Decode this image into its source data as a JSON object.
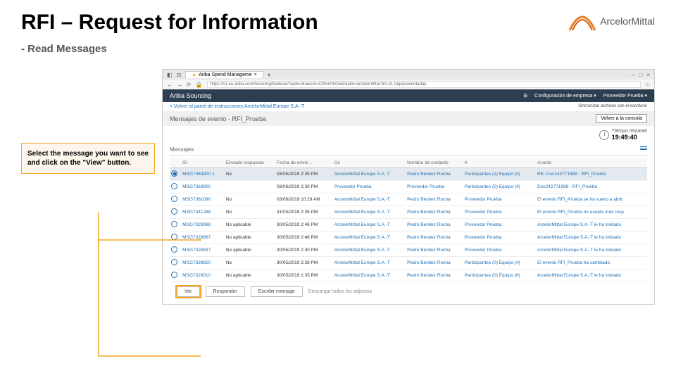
{
  "slide": {
    "title": "RFI – Request for Information",
    "subtitle": "- Read Messages",
    "brand": "ArcelorMittal",
    "callout": "Select the message you want to see and click on the \"View\" button."
  },
  "browser": {
    "tab_title": "Ariba Spend Manageme",
    "url": "https://s1.eu.ariba.com/Sourcing/Main/aw?awh=r&awssk=C0bmVhOe&realm=arcelormittal-NA-IA-1&passwordadap"
  },
  "app": {
    "product": "Ariba Sourcing",
    "config_label": "Configuración de empresa ▾",
    "user_label": "Proveedor Prueba ▾",
    "back_link": "< Volver al panel de instrucciones ArcelorMittal Europe S.A.-T",
    "sync_text": "Sincronizar archivos con el escritorio",
    "page_title": "Mensajes de evento - RFI_Prueba",
    "console_btn": "Volver a la consola",
    "time_label": "Tiempo restante",
    "time_value": "19:49:40",
    "messages_label": "Mensajes",
    "headers": {
      "id": "ID",
      "reply": "Enviado respuesta",
      "date": "Fecha de envío ↓",
      "from": "De",
      "contact": "Nombre de contacto",
      "to": "A",
      "subject": "Asunto"
    },
    "rows": [
      {
        "id": "MSG7363900.1",
        "reply": "No",
        "date": "03/06/2019 2:35 PM",
        "from": "ArcelorMittal Europe S.A.-T",
        "contact": "Pedro Benitez Rocha",
        "to": "Participantes (1) Equipo (4)",
        "subject": "RE: Doc242771989 - RFI_Prueba"
      },
      {
        "id": "MSG7363900",
        "reply": "",
        "date": "03/06/2019 2:30 PM",
        "from": "Proveedor Prueba",
        "contact": "Proveedor Prueba",
        "to": "Participantes (0) Equipo (4)",
        "subject": "Doc242771989 - RFI_Prueba"
      },
      {
        "id": "MSG7361090",
        "reply": "No",
        "date": "03/06/2019 10:28 AM",
        "from": "ArcelorMittal Europe S.A.-T",
        "contact": "Pedro Benitez Rocha",
        "to": "Proveedor Prueba",
        "subject": "El evento RFI_Prueba se ha vuelto a abrir."
      },
      {
        "id": "MSG7341288",
        "reply": "No",
        "date": "31/05/2019 2:35 PM",
        "from": "ArcelorMittal Europe S.A.-T",
        "contact": "Pedro Benitez Rocha",
        "to": "Proveedor Prueba",
        "subject": "El evento RFI_Prueba no acepta más resp"
      },
      {
        "id": "MSG7329988",
        "reply": "No aplicable",
        "date": "30/05/2019 2:46 PM",
        "from": "ArcelorMittal Europe S.A.-T",
        "contact": "Pedro Benitez Rocha",
        "to": "Proveedor Prueba",
        "subject": "ArcelorMittal Europe S.A.-T le ha invitado"
      },
      {
        "id": "MSG7329987",
        "reply": "No aplicable",
        "date": "30/05/2019 2:46 PM",
        "from": "ArcelorMittal Europe S.A.-T",
        "contact": "Pedro Benitez Rocha",
        "to": "Proveedor Prueba",
        "subject": "ArcelorMittal Europe S.A.-T le ha invitado"
      },
      {
        "id": "MSG7329837",
        "reply": "No aplicable",
        "date": "30/05/2019 2:30 PM",
        "from": "ArcelorMittal Europe S.A.-T",
        "contact": "Pedro Benitez Rocha",
        "to": "Proveedor Prueba",
        "subject": "ArcelorMittal Europe S.A.-T le ha invitado"
      },
      {
        "id": "MSG7329820",
        "reply": "No",
        "date": "30/05/2019 2:28 PM",
        "from": "ArcelorMittal Europe S.A.-T",
        "contact": "Pedro Benitez Rocha",
        "to": "Participantes (0) Equipo (4)",
        "subject": "El evento RFI_Prueba ha cambiado."
      },
      {
        "id": "MSG7329010",
        "reply": "No aplicable",
        "date": "30/05/2019 1:35 PM",
        "from": "ArcelorMittal Europe S.A.-T",
        "contact": "Pedro Benitez Rocha",
        "to": "Participantes (0) Equipo (0)",
        "subject": "ArcelorMittal Europe S.A.-T le ha invitado"
      }
    ],
    "actions": {
      "view": "Ver",
      "reply": "Responder",
      "compose": "Escribir mensaje",
      "download": "Descargar todos los adjuntos"
    }
  }
}
